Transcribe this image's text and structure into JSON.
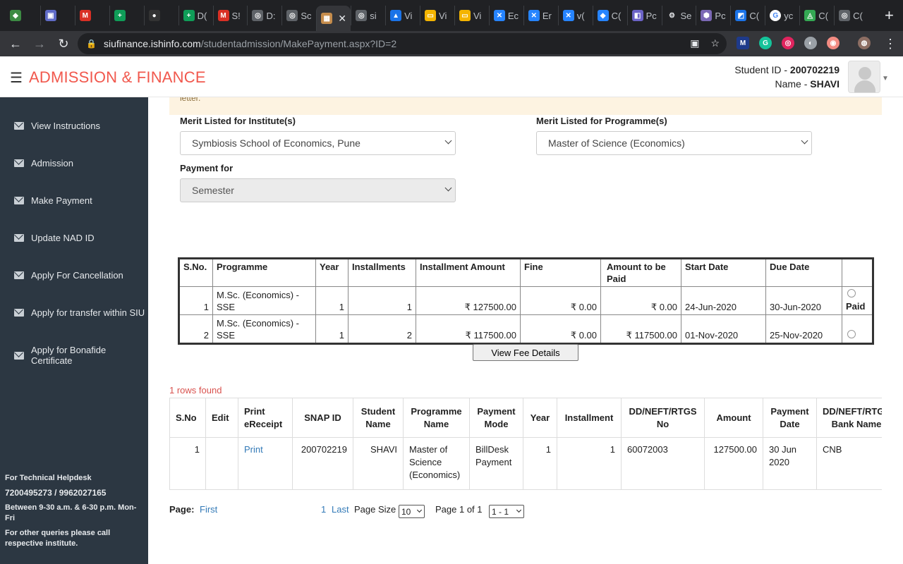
{
  "browser": {
    "tabs": [
      {
        "label": "",
        "color": "#3c8b43",
        "glyph": "◆"
      },
      {
        "label": "",
        "color": "#5f6bc7",
        "glyph": "▣"
      },
      {
        "label": "",
        "color": "#d93025",
        "glyph": "M"
      },
      {
        "label": "",
        "color": "#0f9d58",
        "glyph": "+"
      },
      {
        "label": "",
        "color": "#333333",
        "glyph": "●"
      },
      {
        "label": "D(",
        "color": "#0f9d58",
        "glyph": "+"
      },
      {
        "label": "S!",
        "color": "#d93025",
        "glyph": "M"
      },
      {
        "label": "D:",
        "color": "#5f6368",
        "glyph": "◎"
      },
      {
        "label": "Sc",
        "color": "#5f6368",
        "glyph": "◎"
      },
      {
        "label": "",
        "color": "#c58c4c",
        "glyph": "▦",
        "active": true
      },
      {
        "label": "si",
        "color": "#5f6368",
        "glyph": "◎"
      },
      {
        "label": "Vi",
        "color": "#1a73e8",
        "glyph": "▲"
      },
      {
        "label": "Vi",
        "color": "#f4b400",
        "glyph": "▭"
      },
      {
        "label": "Vi",
        "color": "#f4b400",
        "glyph": "▭"
      },
      {
        "label": "Ec",
        "color": "#2684ff",
        "glyph": "✕"
      },
      {
        "label": "Er",
        "color": "#2684ff",
        "glyph": "✕"
      },
      {
        "label": "v(",
        "color": "#2684ff",
        "glyph": "✕"
      },
      {
        "label": "C(",
        "color": "#2684ff",
        "glyph": "◆"
      },
      {
        "label": "Pc",
        "color": "#6c63c7",
        "glyph": "◧"
      },
      {
        "label": "Se",
        "color": "#e8eaed",
        "glyph": "⚙"
      },
      {
        "label": "Pc",
        "color": "#7b68b5",
        "glyph": "⬢"
      },
      {
        "label": "C(",
        "color": "#1a73e8",
        "glyph": "◩"
      },
      {
        "label": "yc",
        "color": "#ffffff",
        "glyph": "G"
      },
      {
        "label": "C(",
        "color": "#34a853",
        "glyph": "◬"
      },
      {
        "label": "C(",
        "color": "#5f6368",
        "glyph": "◎"
      }
    ],
    "url_host": "siufinance.ishinfo.com",
    "url_path": "/studentadmission/MakePayment.aspx?ID=2",
    "extensions": [
      {
        "glyph": "M",
        "color": "#1e3a8a"
      },
      {
        "glyph": "G",
        "color": "#15c39a"
      },
      {
        "glyph": "◎",
        "color": "#e0245e"
      },
      {
        "glyph": "◐",
        "color": "#9aa0a6"
      },
      {
        "glyph": "◉",
        "color": "#f28b82"
      },
      {
        "glyph": "◍",
        "color": "#8d6e63"
      }
    ]
  },
  "header": {
    "title": "ADMISSION & FINANCE",
    "student_id_label": "Student ID - ",
    "student_id": "200702219",
    "name_label": "Name - ",
    "name": "SHAVI"
  },
  "sidebar": {
    "items": [
      {
        "label": "View Instructions"
      },
      {
        "label": "Admission"
      },
      {
        "label": "Make Payment"
      },
      {
        "label": "Update NAD ID"
      },
      {
        "label": "Apply For Cancellation"
      },
      {
        "label": "Apply for transfer within SIU"
      },
      {
        "label": "Apply for Bonafide Certificate"
      }
    ],
    "helpdesk": {
      "title": "For Technical Helpdesk",
      "phone": "7200495273 / 9962027165",
      "hours": "Between 9-30 a.m. & 6-30 p.m. Mon-Fri",
      "other": "For other queries please call respective institute."
    }
  },
  "notice": {
    "text": "letter."
  },
  "form": {
    "institute_label": "Merit Listed for Institute(s)",
    "institute_value": "Symbiosis School of Economics, Pune",
    "programme_label": "Merit Listed for Programme(s)",
    "programme_value": "Master of Science (Economics)",
    "payment_for_label": "Payment for",
    "payment_for_value": "Semester"
  },
  "fee_table": {
    "headers": [
      "S.No.",
      "Programme",
      "Year",
      "Installments",
      "Installment Amount",
      "Fine",
      "Amount to be Paid",
      "Start Date",
      "Due Date",
      ""
    ],
    "rows": [
      {
        "sno": "1",
        "programme": "M.Sc. (Economics) - SSE",
        "year": "1",
        "installments": "1",
        "amount": "₹ 127500.00",
        "fine": "₹ 0.00",
        "to_pay": "₹ 0.00",
        "start": "24-Jun-2020",
        "due": "30-Jun-2020",
        "status": "Paid"
      },
      {
        "sno": "2",
        "programme": "M.Sc. (Economics) - SSE",
        "year": "1",
        "installments": "2",
        "amount": "₹ 117500.00",
        "fine": "₹ 0.00",
        "to_pay": "₹ 117500.00",
        "start": "01-Nov-2020",
        "due": "25-Nov-2020",
        "status": ""
      }
    ],
    "view_button": "View Fee Details"
  },
  "receipts": {
    "rows_found": "1 rows found",
    "headers": [
      "S.No",
      "Edit",
      "Print eReceipt",
      "SNAP ID",
      "Student Name",
      "Programme Name",
      "Payment Mode",
      "Year",
      "Installment",
      "DD/NEFT/RTGS No",
      "Amount",
      "Payment Date",
      "DD/NEFT/RTGS Bank Name"
    ],
    "rows": [
      {
        "sno": "1",
        "edit": "",
        "print": "Print",
        "snap": "200702219",
        "student": "SHAVI",
        "programme": "Master of Science (Economics)",
        "mode": "BillDesk Payment",
        "year": "1",
        "installment": "1",
        "ref": "60072003",
        "amount": "127500.00",
        "date": "30 Jun 2020",
        "bank": "CNB"
      }
    ]
  },
  "pager": {
    "label": "Page:",
    "first": "First",
    "page_num": "1",
    "last": "Last",
    "page_size_label": "Page Size",
    "page_size": "10",
    "page_of": "Page 1 of 1",
    "range": "1 - 1"
  }
}
